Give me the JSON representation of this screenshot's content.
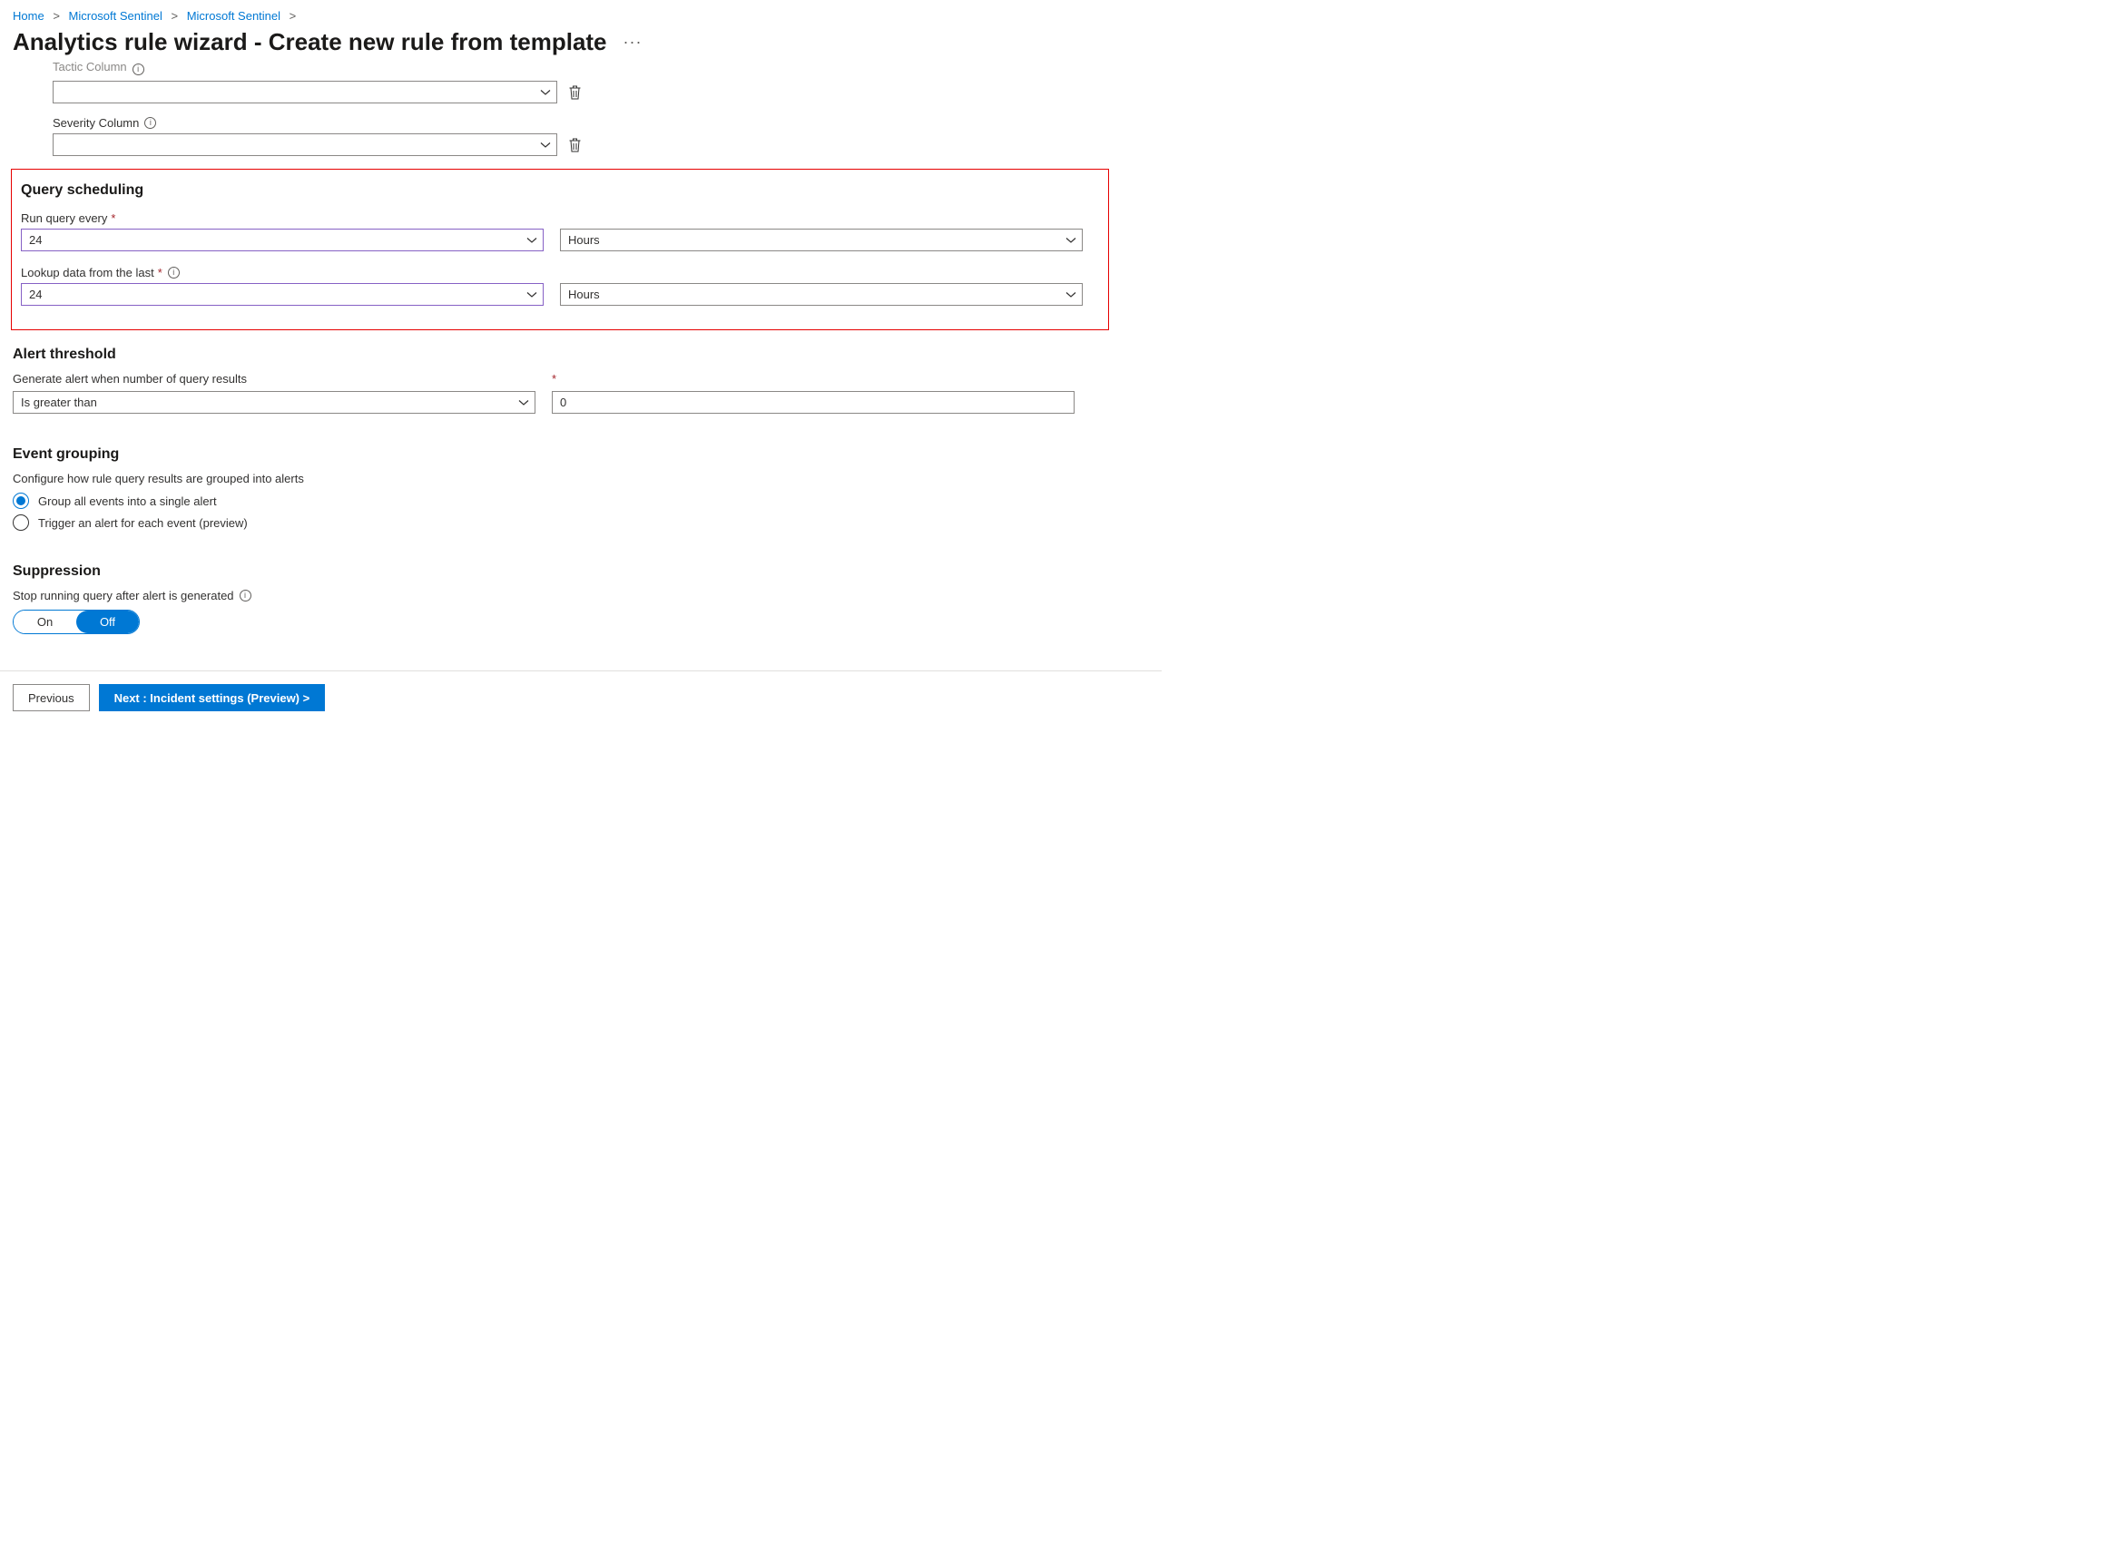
{
  "breadcrumb": {
    "items": [
      "Home",
      "Microsoft Sentinel",
      "Microsoft Sentinel"
    ]
  },
  "page": {
    "title": "Analytics rule wizard - Create new rule from template"
  },
  "tactic": {
    "label_cut": "Tactic Column",
    "value": ""
  },
  "severity": {
    "label": "Severity Column",
    "value": ""
  },
  "scheduling": {
    "heading": "Query scheduling",
    "run_label": "Run query every",
    "run_value": "24",
    "run_unit": "Hours",
    "lookup_label": "Lookup data from the last",
    "lookup_value": "24",
    "lookup_unit": "Hours"
  },
  "threshold": {
    "heading": "Alert threshold",
    "label": "Generate alert when number of query results",
    "operator": "Is greater than",
    "value": "0"
  },
  "grouping": {
    "heading": "Event grouping",
    "description": "Configure how rule query results are grouped into alerts",
    "opt1": "Group all events into a single alert",
    "opt2": "Trigger an alert for each event (preview)"
  },
  "suppression": {
    "heading": "Suppression",
    "label": "Stop running query after alert is generated",
    "on": "On",
    "off": "Off"
  },
  "footer": {
    "prev": "Previous",
    "next": "Next : Incident settings (Preview) >"
  }
}
